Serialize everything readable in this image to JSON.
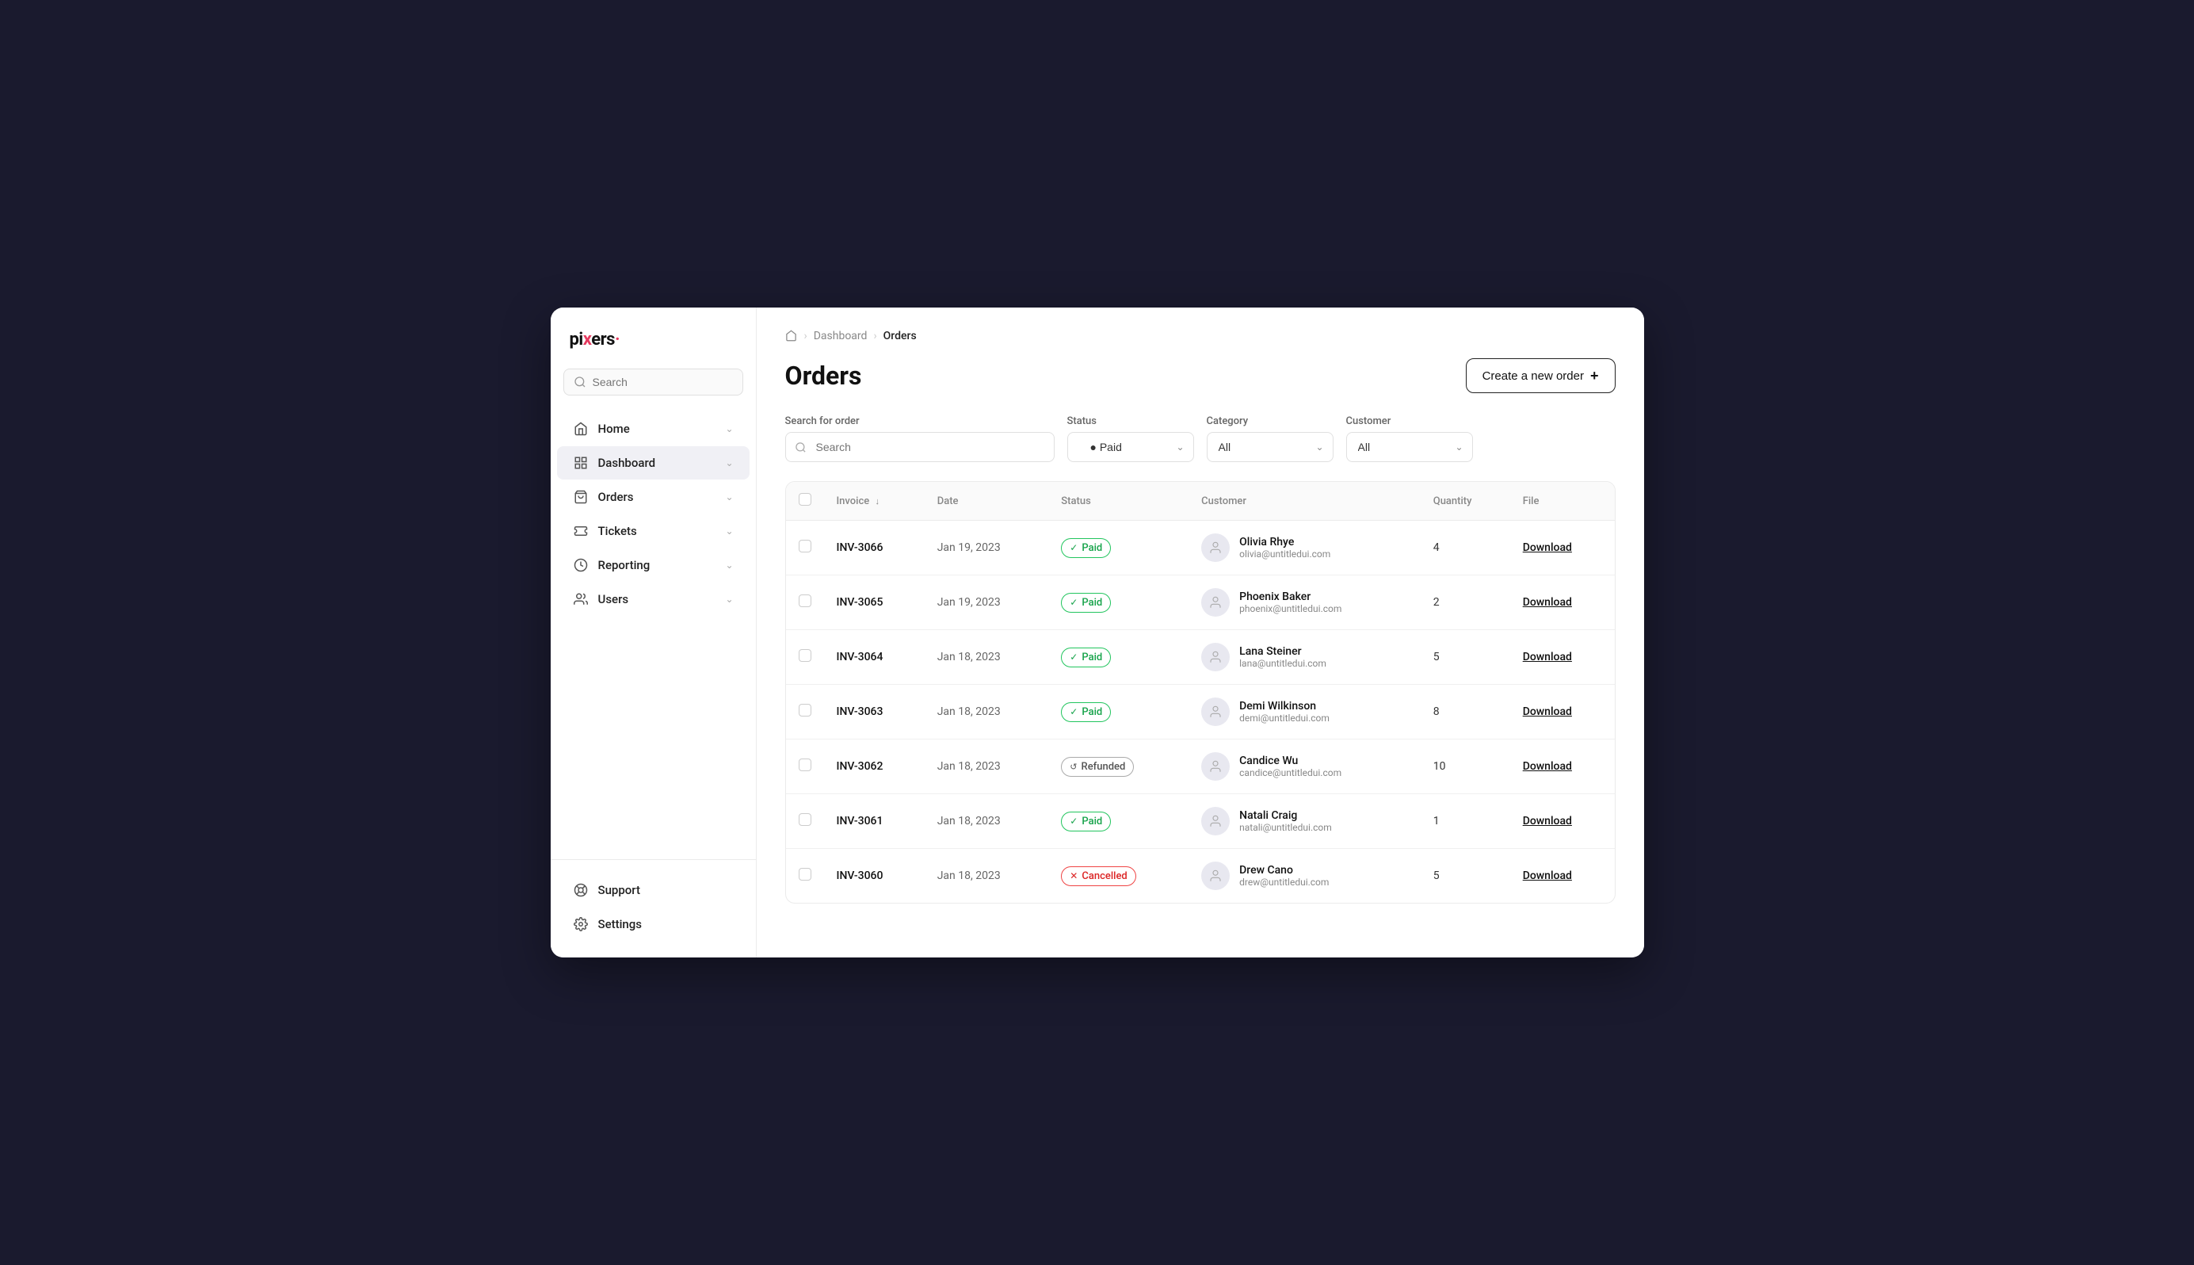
{
  "app": {
    "logo": "pixers",
    "logo_dot_char": "·"
  },
  "sidebar": {
    "search_placeholder": "Search",
    "nav_items": [
      {
        "id": "home",
        "label": "Home",
        "icon": "home-icon",
        "has_chevron": true,
        "active": false
      },
      {
        "id": "dashboard",
        "label": "Dashboard",
        "icon": "dashboard-icon",
        "has_chevron": true,
        "active": true
      },
      {
        "id": "orders",
        "label": "Orders",
        "icon": "orders-icon",
        "has_chevron": true,
        "active": false
      },
      {
        "id": "tickets",
        "label": "Tickets",
        "icon": "tickets-icon",
        "has_chevron": true,
        "active": false
      },
      {
        "id": "reporting",
        "label": "Reporting",
        "icon": "reporting-icon",
        "has_chevron": true,
        "active": false
      },
      {
        "id": "users",
        "label": "Users",
        "icon": "users-icon",
        "has_chevron": true,
        "active": false
      }
    ],
    "bottom_items": [
      {
        "id": "support",
        "label": "Support",
        "icon": "support-icon"
      },
      {
        "id": "settings",
        "label": "Settings",
        "icon": "settings-icon"
      }
    ]
  },
  "breadcrumb": {
    "home_icon": "home",
    "items": [
      {
        "label": "Dashboard",
        "link": true
      },
      {
        "label": "Orders",
        "link": false
      }
    ]
  },
  "page": {
    "title": "Orders",
    "create_button_label": "Create a new order"
  },
  "filters": {
    "search_label": "Search for order",
    "search_placeholder": "Search",
    "status_label": "Status",
    "status_options": [
      {
        "value": "paid",
        "label": "Paid"
      },
      {
        "value": "refunded",
        "label": "Refunded"
      },
      {
        "value": "cancelled",
        "label": "Cancelled"
      }
    ],
    "status_selected": "Paid",
    "category_label": "Category",
    "category_options": [
      {
        "value": "all",
        "label": "All"
      }
    ],
    "category_selected": "All",
    "customer_label": "Customer",
    "customer_options": [
      {
        "value": "all",
        "label": "All"
      }
    ],
    "customer_selected": "All"
  },
  "table": {
    "columns": [
      {
        "id": "checkbox",
        "label": ""
      },
      {
        "id": "invoice",
        "label": "Invoice",
        "sortable": true
      },
      {
        "id": "date",
        "label": "Date"
      },
      {
        "id": "status",
        "label": "Status"
      },
      {
        "id": "customer",
        "label": "Customer"
      },
      {
        "id": "quantity",
        "label": "Quantity"
      },
      {
        "id": "file",
        "label": "File"
      }
    ],
    "rows": [
      {
        "id": "inv-3066",
        "invoice": "INV-3066",
        "date": "Jan 19, 2023",
        "status": "Paid",
        "status_type": "paid",
        "customer_name": "Olivia Rhye",
        "customer_email": "olivia@untitledui.com",
        "quantity": 4,
        "file_label": "Download"
      },
      {
        "id": "inv-3065",
        "invoice": "INV-3065",
        "date": "Jan 19, 2023",
        "status": "Paid",
        "status_type": "paid",
        "customer_name": "Phoenix Baker",
        "customer_email": "phoenix@untitledui.com",
        "quantity": 2,
        "file_label": "Download"
      },
      {
        "id": "inv-3064",
        "invoice": "INV-3064",
        "date": "Jan 18, 2023",
        "status": "Paid",
        "status_type": "paid",
        "customer_name": "Lana Steiner",
        "customer_email": "lana@untitledui.com",
        "quantity": 5,
        "file_label": "Download"
      },
      {
        "id": "inv-3063",
        "invoice": "INV-3063",
        "date": "Jan 18, 2023",
        "status": "Paid",
        "status_type": "paid",
        "customer_name": "Demi Wilkinson",
        "customer_email": "demi@untitledui.com",
        "quantity": 8,
        "file_label": "Download"
      },
      {
        "id": "inv-3062",
        "invoice": "INV-3062",
        "date": "Jan 18, 2023",
        "status": "Refunded",
        "status_type": "refunded",
        "customer_name": "Candice Wu",
        "customer_email": "candice@untitledui.com",
        "quantity": 10,
        "file_label": "Download"
      },
      {
        "id": "inv-3061",
        "invoice": "INV-3061",
        "date": "Jan 18, 2023",
        "status": "Paid",
        "status_type": "paid",
        "customer_name": "Natali Craig",
        "customer_email": "natali@untitledui.com",
        "quantity": 1,
        "file_label": "Download"
      },
      {
        "id": "inv-3060",
        "invoice": "INV-3060",
        "date": "Jan 18, 2023",
        "status": "Cancelled",
        "status_type": "cancelled",
        "customer_name": "Drew Cano",
        "customer_email": "drew@untitledui.com",
        "quantity": 5,
        "file_label": "Download"
      }
    ]
  }
}
